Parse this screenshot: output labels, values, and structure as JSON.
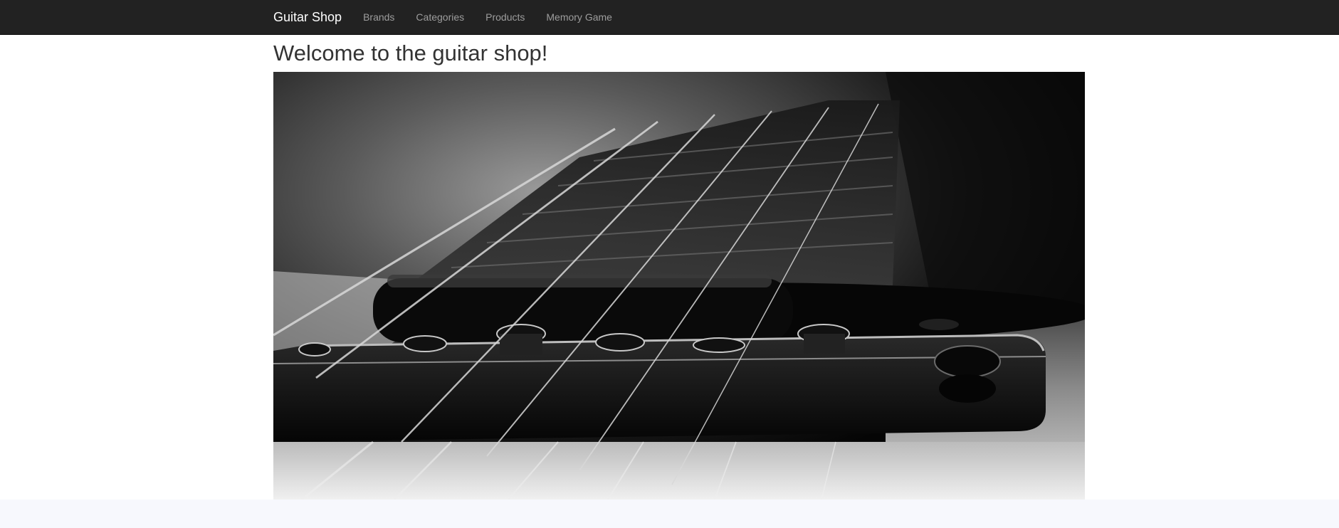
{
  "navbar": {
    "brand": "Guitar Shop",
    "links": [
      {
        "label": "Brands"
      },
      {
        "label": "Categories"
      },
      {
        "label": "Products"
      },
      {
        "label": "Memory Game"
      }
    ]
  },
  "main": {
    "heading": "Welcome to the guitar shop!"
  },
  "colors": {
    "navbar_bg": "#222222",
    "brand_text": "#ffffff",
    "nav_link_text": "#9d9d9d",
    "heading_text": "#333333",
    "footer_bg": "#f7f8fd"
  }
}
